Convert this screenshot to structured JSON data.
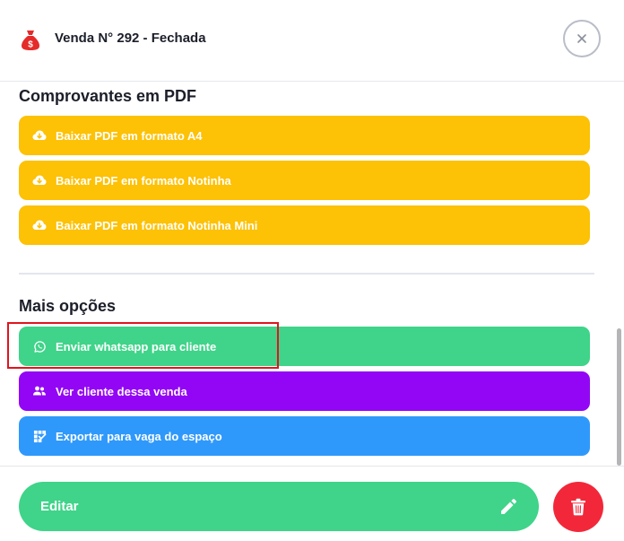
{
  "header": {
    "title": "Venda N° 292 - Fechada",
    "icon": "money-bag-icon",
    "close_icon": "close-icon"
  },
  "pdf_section": {
    "title": "Comprovantes em PDF",
    "buttons": [
      {
        "label": "Baixar PDF em formato A4",
        "icon": "cloud-download-icon"
      },
      {
        "label": "Baixar PDF em formato Notinha",
        "icon": "cloud-download-icon"
      },
      {
        "label": "Baixar PDF em formato Notinha Mini",
        "icon": "cloud-download-icon"
      }
    ]
  },
  "more_section": {
    "title": "Mais opções",
    "buttons": [
      {
        "label": "Enviar whatsapp para cliente",
        "icon": "whatsapp-icon"
      },
      {
        "label": "Ver cliente dessa venda",
        "icon": "users-icon"
      },
      {
        "label": "Exportar para vaga do espaço",
        "icon": "calendar-check-icon"
      }
    ]
  },
  "footer": {
    "edit_label": "Editar",
    "edit_icon": "pencil-icon",
    "delete_icon": "trash-icon"
  },
  "colors": {
    "yellow": "#fdc105",
    "green": "#3fd489",
    "purple": "#9306f5",
    "blue": "#2f99fb",
    "red": "#f2283a",
    "highlight": "#e0141e"
  }
}
